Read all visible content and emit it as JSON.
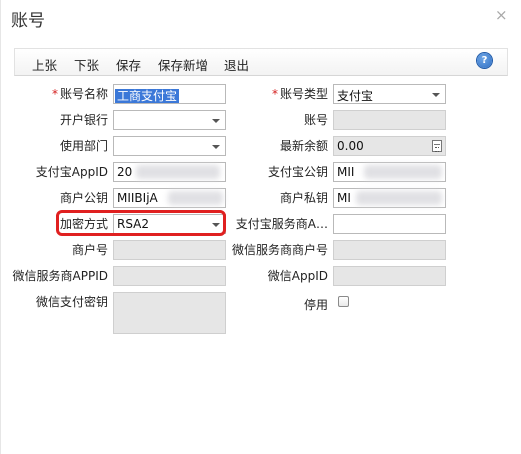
{
  "window": {
    "title": "账号",
    "close_glyph": "×"
  },
  "toolbar": {
    "buttons": [
      {
        "label": "上张"
      },
      {
        "label": "下张"
      },
      {
        "label": "保存"
      },
      {
        "label": "保存新增"
      },
      {
        "label": "退出"
      }
    ],
    "help_glyph": "?"
  },
  "form": {
    "account_name": {
      "label": "账号名称",
      "value": "工商支付宝"
    },
    "bank": {
      "label": "开户银行",
      "value": ""
    },
    "department": {
      "label": "使用部门",
      "value": ""
    },
    "alipay_appid": {
      "label": "支付宝AppID",
      "value": "20"
    },
    "merchant_public_key": {
      "label": "商户公钥",
      "value": "MIIBIjA"
    },
    "encryption": {
      "label": "加密方式",
      "value": "RSA2"
    },
    "merchant_no": {
      "label": "商户号",
      "value": ""
    },
    "wechat_sp_appid": {
      "label": "微信服务商APPID",
      "value": ""
    },
    "wechat_pay_secret": {
      "label": "微信支付密钥",
      "value": ""
    },
    "account_type": {
      "label": "账号类型",
      "value": "支付宝"
    },
    "account_no": {
      "label": "账号",
      "value": ""
    },
    "latest_balance": {
      "label": "最新余额",
      "value": "0.00"
    },
    "alipay_public_key": {
      "label": "支付宝公钥",
      "value": "MII"
    },
    "merchant_private_key": {
      "label": "商户私钥",
      "value": "MI"
    },
    "alipay_sp": {
      "label": "支付宝服务商A…",
      "value": ""
    },
    "wechat_sp_merchant_no": {
      "label": "微信服务商商户号",
      "value": ""
    },
    "wechat_appid": {
      "label": "微信AppID",
      "value": ""
    },
    "disabled": {
      "label": "停用",
      "checked": false
    }
  },
  "required_mark": "*",
  "colors": {
    "highlight": "#e02020",
    "selection": "#3b78d8",
    "readonly_bg": "#e6e6e6"
  }
}
